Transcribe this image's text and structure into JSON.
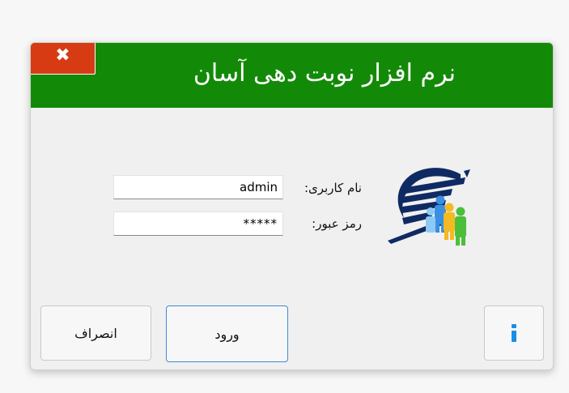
{
  "window": {
    "title": "نرم افزار نوبت دهی آسان",
    "close_glyph": "✖",
    "titlebar_color": "#138a07",
    "close_color": "#d63b14"
  },
  "form": {
    "username_label": "نام کاربری:",
    "username_value": "admin",
    "password_label": "رمز عبور:",
    "password_value": "*****"
  },
  "buttons": {
    "login_label": "ورود",
    "cancel_label": "انصراف",
    "info_icon": "info-icon",
    "info_color": "#1a8ee6"
  },
  "logo": {
    "icon": "queue-people-logo"
  }
}
